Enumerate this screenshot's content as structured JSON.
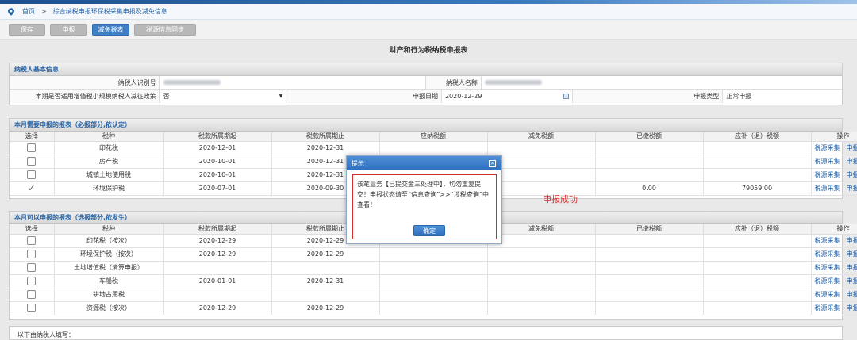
{
  "breadcrumb": {
    "home": "首页",
    "separator": ">",
    "current": "综合纳税申报环保税采集申报及减免信息"
  },
  "toolbar": {
    "save": "保存",
    "declare": "申报",
    "reduce_table": "减免税表",
    "sync": "税源信息同步"
  },
  "page_title": "财产和行为税纳税申报表",
  "basic_info": {
    "header": "纳税人基本信息",
    "taxpayer_id_label": "纳税人识别号",
    "taxpayer_name_label": "纳税人名称",
    "small_scale_label": "本期是否适用增值税小规模纳税人减征政策",
    "small_scale_value": "否",
    "declare_date_label": "申报日期",
    "declare_date_value": "2020-12-29",
    "declare_type_label": "申报类型",
    "declare_type_value": "正常申报"
  },
  "required_table": {
    "header": "本月需要申报的报表（必报部分,依认定）",
    "columns": [
      "选择",
      "税种",
      "税款所属期起",
      "税款所属期止",
      "应纳税额",
      "减免税额",
      "已缴税额",
      "应补（退）税额",
      "操作"
    ],
    "rows": [
      {
        "checked": false,
        "tax": "印花税",
        "start": "2020-12-01",
        "end": "2020-12-31",
        "payable": "",
        "reduce": "",
        "paid": "",
        "due": "",
        "op1": "税源采集",
        "op2": "申报明细"
      },
      {
        "checked": false,
        "tax": "房产税",
        "start": "2020-10-01",
        "end": "2020-12-31",
        "payable": "",
        "reduce": "",
        "paid": "",
        "due": "",
        "op1": "税源采集",
        "op2": "申报明细"
      },
      {
        "checked": false,
        "tax": "城镇土地使用税",
        "start": "2020-10-01",
        "end": "2020-12-31",
        "payable": "",
        "reduce": "",
        "paid": "",
        "due": "",
        "op1": "税源采集",
        "op2": "申报明细"
      },
      {
        "checked": true,
        "tax": "环境保护税",
        "start": "2020-07-01",
        "end": "2020-09-30",
        "payable": "",
        "reduce": "",
        "paid": "0.00",
        "due": "79059.00",
        "op1": "税源采集",
        "op2": "申报明细"
      }
    ]
  },
  "optional_table": {
    "header": "本月可以申报的报表（选报部分,依发生）",
    "columns": [
      "选择",
      "税种",
      "税款所属期起",
      "税款所属期止",
      "应纳税额",
      "减免税额",
      "已缴税额",
      "应补（退）税额",
      "操作"
    ],
    "rows": [
      {
        "tax": "印花税（按次）",
        "start": "2020-12-29",
        "end": "2020-12-29",
        "op1": "税源采集",
        "op2": "申报明细"
      },
      {
        "tax": "环境保护税（按次）",
        "start": "2020-12-29",
        "end": "2020-12-29",
        "op1": "税源采集",
        "op2": "申报明细"
      },
      {
        "tax": "土地增值税（清算申报）",
        "start": "",
        "end": "",
        "op1": "税源采集",
        "op2": "申报明细"
      },
      {
        "tax": "车船税",
        "start": "2020-01-01",
        "end": "2020-12-31",
        "op1": "税源采集",
        "op2": "申报明细"
      },
      {
        "tax": "耕地占用税",
        "start": "",
        "end": "",
        "op1": "税源采集",
        "op2": "申报明细"
      },
      {
        "tax": "资源税（按次）",
        "start": "2020-12-29",
        "end": "2020-12-29",
        "op1": "税源采集",
        "op2": "申报明细"
      }
    ]
  },
  "success_text": "申报成功",
  "footer_note": "以下由纳税人填写：",
  "modal": {
    "title": "提示",
    "message": "该笔业务【已提交金三处理中】，切勿重复提交！申报状态请至“信息查询”>>“涉税查询”中查看！",
    "ok": "确定"
  },
  "colors": {
    "accent": "#2563a8",
    "modal_header": "#3f7fc6",
    "alert": "#e23030"
  }
}
